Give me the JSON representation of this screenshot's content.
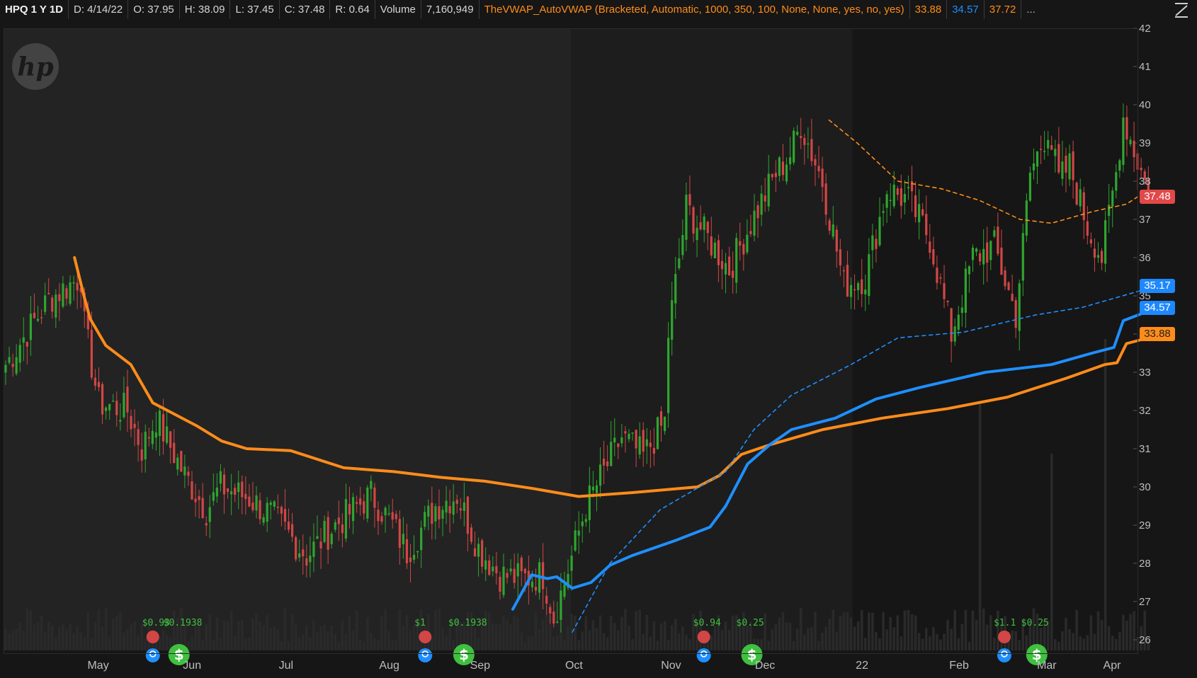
{
  "header": {
    "symbol": "HPQ 1 Y 1D",
    "date": "D: 4/14/22",
    "open": "O: 37.95",
    "high": "H: 38.09",
    "low": "L: 37.45",
    "close": "C: 37.48",
    "range": "R: 0.64",
    "volume_label": "Volume",
    "volume_value": "7,160,949",
    "study": "TheVWAP_AutoVWAP (Bracketed, Automatic, 1000, 350, 100, None, None, yes, no, yes)",
    "study_v1": "33.88",
    "study_v2": "34.57",
    "study_v3": "37.72",
    "more": "...",
    "collapse_icon": "collapse-icon"
  },
  "logo": "hp",
  "price_labels": {
    "close": "37.48",
    "upper_band": "35.17",
    "vwap": "34.57",
    "lower": "33.88"
  },
  "colors": {
    "background": "#161616",
    "shade_light": "#232323",
    "shade_mid": "#1d1d1d",
    "up": "#2fa52f",
    "down": "#d24646",
    "vwap_orange": "#ff8c1a",
    "vwap_blue": "#1f8fff",
    "volume": "#2a2a2a",
    "event_green": "#3fc03f",
    "event_red": "#d24646",
    "event_blue": "#1f8fff"
  },
  "chart_data": {
    "type": "candlestick",
    "symbol": "HPQ",
    "timeframe": "1Y 1D",
    "y_axis": {
      "ticks": [
        26,
        27,
        28,
        29,
        30,
        31,
        32,
        33,
        34,
        35,
        36,
        37,
        38,
        39,
        40,
        41,
        42
      ],
      "range": [
        25.85,
        42.05
      ]
    },
    "x_axis": {
      "months": [
        "May",
        "Jun",
        "Jul",
        "Aug",
        "Sep",
        "Oct",
        "Nov",
        "Dec",
        "22",
        "Feb",
        "Mar",
        "Apr"
      ]
    },
    "start_date": "2021-04-15",
    "end_date": "2022-04-14",
    "close_path": [
      [
        0,
        33.2
      ],
      [
        12,
        34.9
      ],
      [
        21,
        35.5
      ],
      [
        22,
        34.2
      ],
      [
        26,
        32.2
      ],
      [
        34,
        32.0
      ],
      [
        38,
        31.0
      ],
      [
        42,
        31.8
      ],
      [
        50,
        30.3
      ],
      [
        56,
        29.4
      ],
      [
        60,
        30.0
      ],
      [
        68,
        29.7
      ],
      [
        75,
        29.2
      ],
      [
        84,
        28.2
      ],
      [
        92,
        29.0
      ],
      [
        102,
        29.8
      ],
      [
        108,
        29.0
      ],
      [
        112,
        28.3
      ],
      [
        120,
        29.5
      ],
      [
        126,
        29.8
      ],
      [
        132,
        28.4
      ],
      [
        138,
        27.7
      ],
      [
        144,
        27.6
      ],
      [
        150,
        27.7
      ],
      [
        153,
        26.6
      ],
      [
        156,
        27.5
      ],
      [
        162,
        29.5
      ],
      [
        172,
        31.3
      ],
      [
        178,
        30.8
      ],
      [
        184,
        31.7
      ],
      [
        185,
        34.0
      ],
      [
        190,
        37.3
      ],
      [
        196,
        36.5
      ],
      [
        202,
        35.7
      ],
      [
        208,
        36.9
      ],
      [
        215,
        38.2
      ],
      [
        219,
        38.7
      ],
      [
        222,
        39.5
      ],
      [
        228,
        38.0
      ],
      [
        234,
        35.3
      ],
      [
        240,
        35.5
      ],
      [
        246,
        37.8
      ],
      [
        252,
        37.5
      ],
      [
        258,
        36.5
      ],
      [
        264,
        34.0
      ],
      [
        270,
        36.0
      ],
      [
        276,
        36.3
      ],
      [
        282,
        34.5
      ],
      [
        286,
        38.2
      ],
      [
        291,
        39.4
      ],
      [
        294,
        38.0
      ],
      [
        297,
        38.4
      ],
      [
        302,
        36.8
      ],
      [
        306,
        36.0
      ],
      [
        310,
        38.2
      ],
      [
        312,
        39.7
      ],
      [
        315,
        38.8
      ],
      [
        318,
        38.0
      ],
      [
        319,
        37.48
      ]
    ],
    "volume": {
      "baseline_units": "relative",
      "spikes": [
        {
          "day": 272,
          "rel": 0.75
        },
        {
          "day": 307,
          "rel": 1.0
        },
        {
          "day": 292,
          "rel": 0.55
        }
      ]
    },
    "series": [
      {
        "name": "TheVWAP_AutoVWAP lower",
        "color": "#ff8c1a",
        "values": [
          [
            "2021-05-07",
            36.0
          ],
          [
            "2021-05-10",
            35.0
          ],
          [
            "2021-05-12",
            34.4
          ],
          [
            "2021-05-17",
            33.7
          ],
          [
            "2021-05-25",
            33.2
          ],
          [
            "2021-06-01",
            32.2
          ],
          [
            "2021-06-15",
            31.6
          ],
          [
            "2021-06-23",
            31.2
          ],
          [
            "2021-07-01",
            31.0
          ],
          [
            "2021-07-15",
            30.95
          ],
          [
            "2021-08-01",
            30.5
          ],
          [
            "2021-08-17",
            30.4
          ],
          [
            "2021-09-01",
            30.25
          ],
          [
            "2021-09-15",
            30.15
          ],
          [
            "2021-10-01",
            29.95
          ],
          [
            "2021-10-15",
            29.75
          ],
          [
            "2021-11-01",
            29.85
          ],
          [
            "2021-11-22",
            30.0
          ],
          [
            "2021-11-29",
            30.3
          ],
          [
            "2021-12-06",
            30.85
          ],
          [
            "2021-12-15",
            31.1
          ],
          [
            "2022-01-01",
            31.5
          ],
          [
            "2022-01-20",
            31.8
          ],
          [
            "2022-02-10",
            32.05
          ],
          [
            "2022-03-01",
            32.35
          ],
          [
            "2022-03-20",
            32.85
          ],
          [
            "2022-04-01",
            33.2
          ],
          [
            "2022-04-05",
            33.25
          ],
          [
            "2022-04-08",
            33.75
          ],
          [
            "2022-04-14",
            33.88
          ]
        ]
      },
      {
        "name": "TheVWAP_AutoVWAP mid",
        "color": "#1f8fff",
        "values": [
          [
            "2021-09-24",
            26.8
          ],
          [
            "2021-09-30",
            27.7
          ],
          [
            "2021-10-05",
            27.6
          ],
          [
            "2021-10-08",
            27.65
          ],
          [
            "2021-10-13",
            27.35
          ],
          [
            "2021-10-19",
            27.5
          ],
          [
            "2021-10-25",
            27.95
          ],
          [
            "2021-11-01",
            28.2
          ],
          [
            "2021-11-15",
            28.6
          ],
          [
            "2021-11-26",
            28.95
          ],
          [
            "2021-12-01",
            29.5
          ],
          [
            "2021-12-08",
            30.6
          ],
          [
            "2021-12-15",
            31.1
          ],
          [
            "2021-12-22",
            31.5
          ],
          [
            "2022-01-05",
            31.8
          ],
          [
            "2022-01-18",
            32.3
          ],
          [
            "2022-02-01",
            32.6
          ],
          [
            "2022-02-22",
            33.0
          ],
          [
            "2022-03-15",
            33.2
          ],
          [
            "2022-03-28",
            33.5
          ],
          [
            "2022-04-04",
            33.65
          ],
          [
            "2022-04-07",
            34.35
          ],
          [
            "2022-04-14",
            34.57
          ]
        ]
      },
      {
        "name": "TheVWAP_AutoVWAP upper band",
        "color": "#1f8fff",
        "dashed": true,
        "values": [
          [
            "2021-10-13",
            26.2
          ],
          [
            "2021-10-25",
            28.0
          ],
          [
            "2021-11-10",
            29.4
          ],
          [
            "2021-12-01",
            30.4
          ],
          [
            "2021-12-10",
            31.5
          ],
          [
            "2021-12-22",
            32.4
          ],
          [
            "2022-01-10",
            33.2
          ],
          [
            "2022-01-25",
            33.9
          ],
          [
            "2022-02-15",
            34.05
          ],
          [
            "2022-03-10",
            34.5
          ],
          [
            "2022-03-25",
            34.7
          ],
          [
            "2022-04-14",
            35.17
          ]
        ]
      },
      {
        "name": "TheVWAP_AutoVWAP upper",
        "color": "#ff8c1a",
        "dashed": true,
        "values": [
          [
            "2022-01-03",
            39.6
          ],
          [
            "2022-01-12",
            39.0
          ],
          [
            "2022-01-25",
            38.0
          ],
          [
            "2022-02-08",
            37.8
          ],
          [
            "2022-02-20",
            37.5
          ],
          [
            "2022-03-05",
            37.0
          ],
          [
            "2022-03-15",
            36.9
          ],
          [
            "2022-03-28",
            37.2
          ],
          [
            "2022-04-08",
            37.4
          ],
          [
            "2022-04-14",
            37.72
          ]
        ]
      }
    ],
    "events": [
      {
        "date": "2021-06-01",
        "label": "$0.93",
        "type": "earnings"
      },
      {
        "date": "2021-06-08",
        "label": "$0.1938",
        "type": "dividend"
      },
      {
        "date": "2021-08-27",
        "label": "$1",
        "type": "earnings"
      },
      {
        "date": "2021-09-07",
        "label": "$0.1938",
        "type": "dividend"
      },
      {
        "date": "2021-11-24",
        "label": "$0.94",
        "type": "earnings"
      },
      {
        "date": "2021-12-08",
        "label": "$0.25",
        "type": "dividend"
      },
      {
        "date": "2022-02-28",
        "label": "$1.1",
        "type": "earnings"
      },
      {
        "date": "2022-03-09",
        "label": "$0.25",
        "type": "dividend"
      }
    ],
    "shading": [
      {
        "from": "2021-04-15",
        "to": "2021-10-12",
        "shade": "light"
      },
      {
        "from": "2021-10-13",
        "to": "2022-01-10",
        "shade": "mid"
      },
      {
        "from": "2022-01-11",
        "to": "2022-04-14",
        "shade": "dark"
      }
    ]
  }
}
